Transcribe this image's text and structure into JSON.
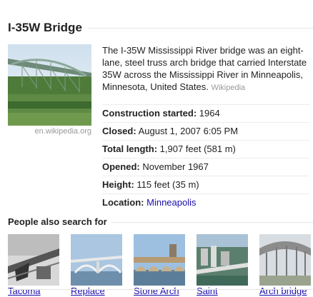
{
  "panel": {
    "title": "I-35W Bridge",
    "description": "The I-35W Mississippi River bridge was an eight-lane, steel truss arch bridge that carried Interstate 35W across the Mississippi River in Minneapolis, Minnesota, United States.",
    "description_source": "Wikipedia",
    "image_source": "en.wikipedia.org"
  },
  "facts": [
    {
      "label": "Construction started:",
      "value": "1964"
    },
    {
      "label": "Closed:",
      "value": "August 1, 2007 6:05 PM"
    },
    {
      "label": "Total length:",
      "value": "1,907 feet (581 m)"
    },
    {
      "label": "Opened:",
      "value": "November 1967"
    },
    {
      "label": "Height:",
      "value": "115 feet (35 m)"
    },
    {
      "label": "Location:",
      "value": "Minneapolis"
    }
  ],
  "people_also_search": {
    "title": "People also search for",
    "items": [
      {
        "label": "Tacoma"
      },
      {
        "label": "Replace"
      },
      {
        "label": "Stone Arch"
      },
      {
        "label": "Saint"
      },
      {
        "label": "Arch bridge"
      }
    ]
  },
  "colors": {
    "link": "#1a0dab",
    "muted": "#999999",
    "text": "#222222"
  }
}
